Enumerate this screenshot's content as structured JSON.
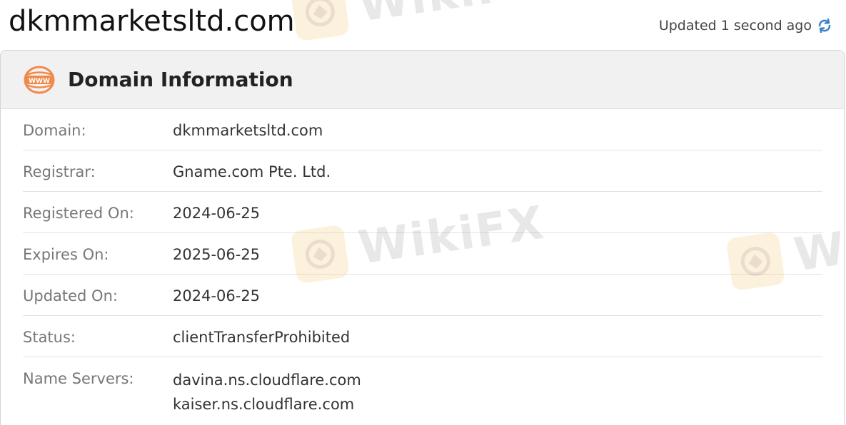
{
  "header": {
    "site_title": "dkmmarketsltd.com",
    "updated_text": "Updated 1 second ago",
    "refresh_icon": "refresh-icon"
  },
  "card": {
    "title": "Domain Information",
    "icon": "www-icon",
    "rows": [
      {
        "label": "Domain:",
        "value": "dkmmarketsltd.com"
      },
      {
        "label": "Registrar:",
        "value": "Gname.com Pte. Ltd."
      },
      {
        "label": "Registered On:",
        "value": "2024-06-25"
      },
      {
        "label": "Expires On:",
        "value": "2025-06-25"
      },
      {
        "label": "Updated On:",
        "value": "2024-06-25"
      },
      {
        "label": "Status:",
        "value": "clientTransferProhibited"
      },
      {
        "label": "Name Servers:",
        "values": [
          "davina.ns.cloudflare.com",
          "kaiser.ns.cloudflare.com"
        ]
      }
    ]
  },
  "watermark": {
    "text": "WikiFX"
  },
  "colors": {
    "accent_orange": "#f08a4b",
    "refresh_blue": "#3b82c4",
    "header_bg": "#f1f1f1"
  }
}
